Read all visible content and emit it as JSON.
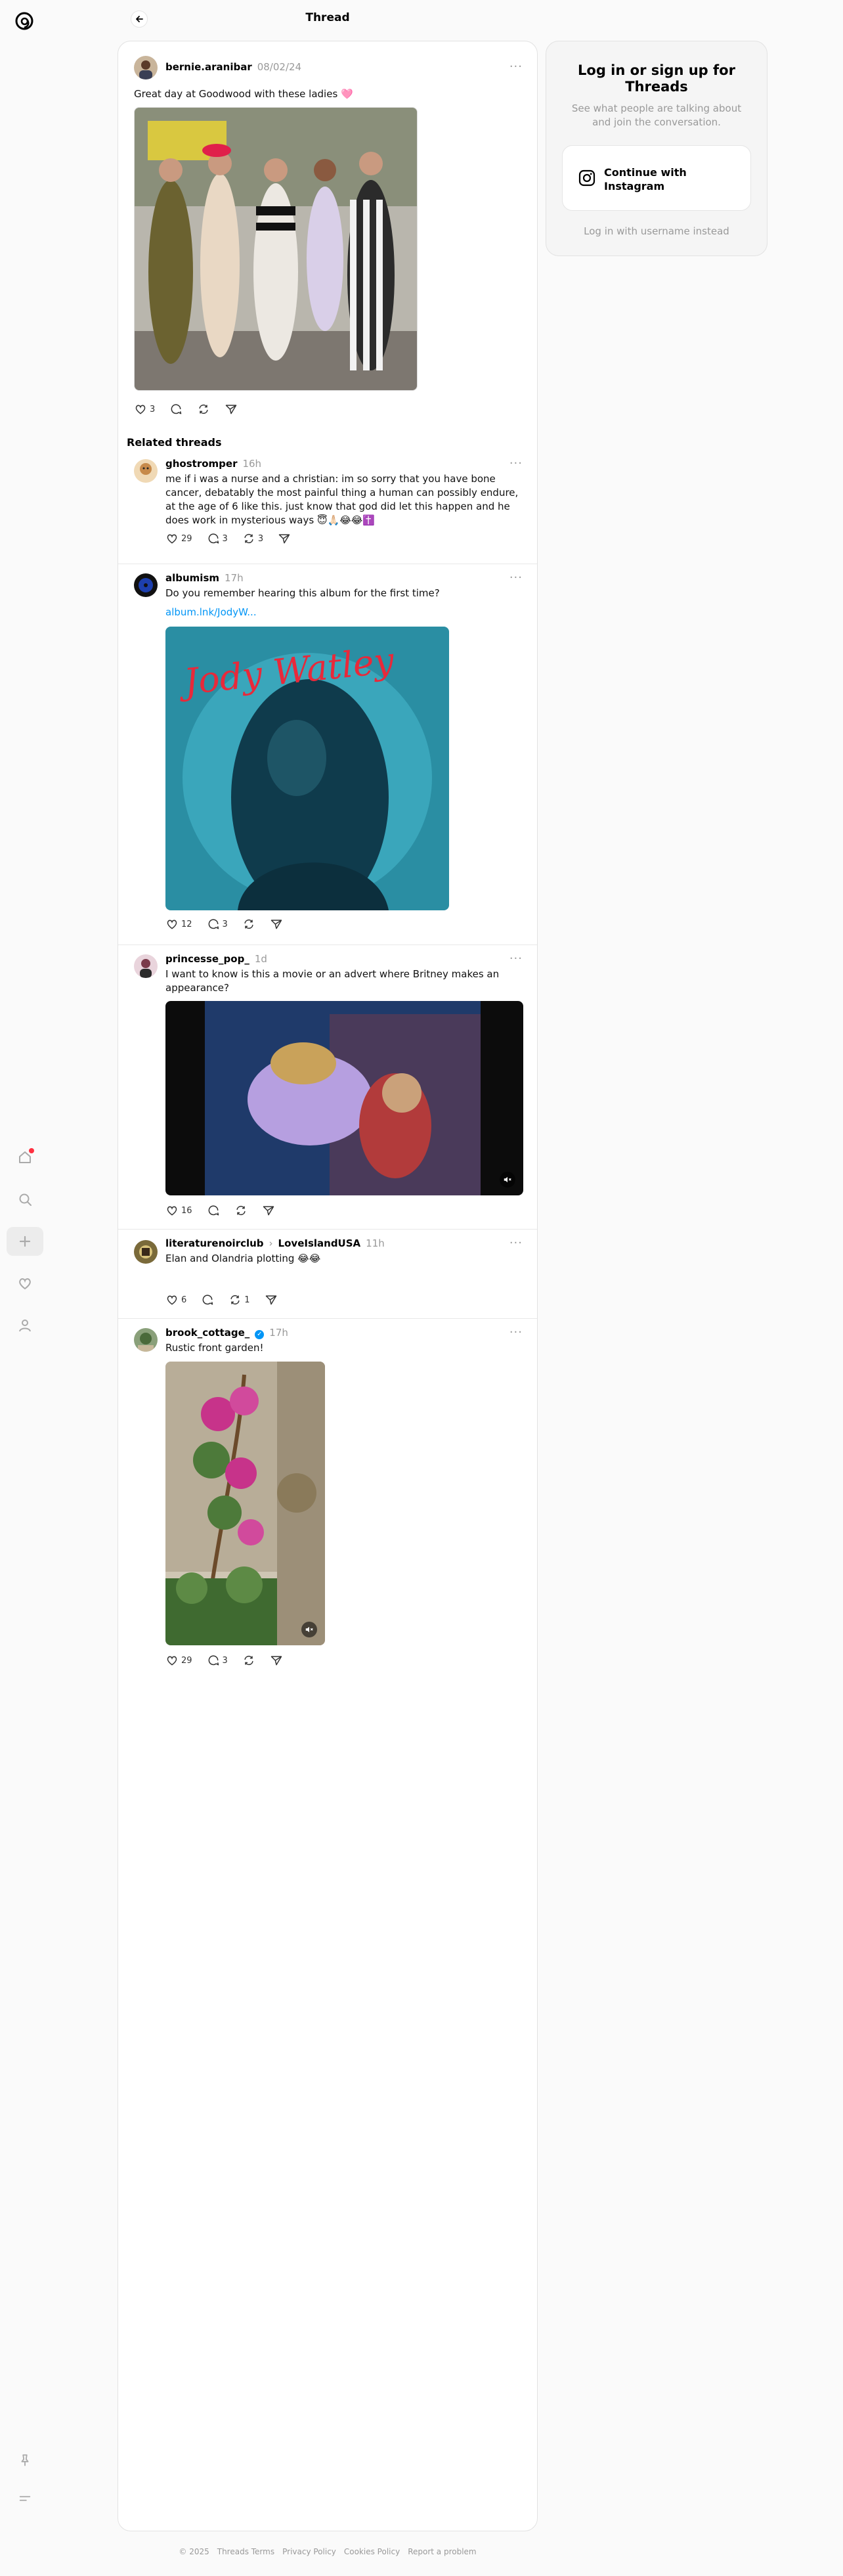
{
  "header": {
    "title": "Thread"
  },
  "main_post": {
    "username": "bernie.aranibar",
    "time": "08/02/24",
    "text": "Great day at Goodwood with these ladies 🩷",
    "likes": "3"
  },
  "related": {
    "heading": "Related threads",
    "posts": [
      {
        "username": "ghostromper",
        "time": "16h",
        "text": "me if i was a nurse and a christian: im so sorry that you have bone cancer, debatably the most painful thing a human can possibly endure, at the age of 6 like this. just know that god did let this happen and he does work in mysterious ways 😇🙏🏻😂😂✝️",
        "likes": "29",
        "replies": "3",
        "reposts": "3"
      },
      {
        "username": "albumism",
        "time": "17h",
        "text": "Do you remember hearing this album for the first time?",
        "link": "album.lnk/JodyW...",
        "album_script": "Jody Watley",
        "likes": "12",
        "replies": "3"
      },
      {
        "username": "princesse_pop_",
        "time": "1d",
        "text": "I want to know is this a movie or an advert where Britney makes an appearance?",
        "likes": "16"
      },
      {
        "username": "literaturenoirclub",
        "separator": "›",
        "community": "LoveIslandUSA",
        "time": "11h",
        "text": "Elan and Olandria plotting 😂😂",
        "likes": "6",
        "reposts": "1"
      },
      {
        "username": "brook_cottage_",
        "time": "17h",
        "text": "Rustic front garden!",
        "likes": "29",
        "replies": "3"
      }
    ]
  },
  "login": {
    "title": "Log in or sign up for Threads",
    "subtitle": "See what people are talking about and join the conversation.",
    "instagram_button": "Continue with Instagram",
    "username_link": "Log in with username instead"
  },
  "footer": {
    "copyright": "© 2025",
    "links": [
      "Threads Terms",
      "Privacy Policy",
      "Cookies Policy",
      "Report a problem"
    ]
  },
  "colors": {
    "link": "#0095f6",
    "notification": "#ff3040",
    "verified": "#0095f6"
  }
}
